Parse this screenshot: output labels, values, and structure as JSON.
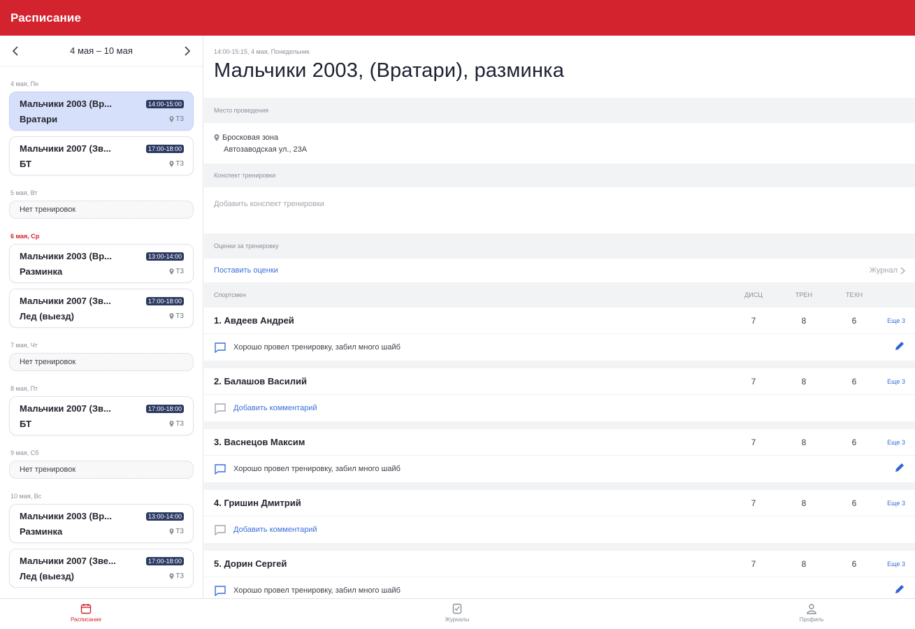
{
  "app": {
    "title": "Расписание",
    "accent": "#d3232e"
  },
  "week": {
    "range": "4 мая – 10 мая"
  },
  "days": [
    {
      "label": "4 мая, Пн",
      "today": false,
      "items": [
        {
          "name": "Мальчики  2003 (Вр...",
          "time": "14:00-15:00",
          "sub": "Вратари",
          "loc": "Т3",
          "selected": true
        },
        {
          "name": "Мальчики  2007 (Зв...",
          "time": "17:00-18:00",
          "sub": "БТ",
          "loc": "Т3",
          "selected": false
        }
      ]
    },
    {
      "label": "5 мая, Вт",
      "today": false,
      "empty": "Нет тренировок"
    },
    {
      "label": "6 мая, Ср",
      "today": true,
      "items": [
        {
          "name": "Мальчики  2003 (Вр...",
          "time": "13:00-14:00",
          "sub": "Разминка",
          "loc": "Т3",
          "selected": false
        },
        {
          "name": "Мальчики  2007 (Зв...",
          "time": "17:00-18:00",
          "sub": "Лед (выезд)",
          "loc": "Т3",
          "selected": false
        }
      ]
    },
    {
      "label": "7 мая, Чт",
      "today": false,
      "empty": "Нет тренировок"
    },
    {
      "label": "8 мая, Пт",
      "today": false,
      "items": [
        {
          "name": "Мальчики  2007 (Зв...",
          "time": "17:00-18:00",
          "sub": "БТ",
          "loc": "Т3",
          "selected": false
        }
      ]
    },
    {
      "label": "9 мая, Сб",
      "today": false,
      "empty": "Нет тренировок"
    },
    {
      "label": "10 мая, Вс",
      "today": false,
      "items": [
        {
          "name": "Мальчики  2003 (Вр...",
          "time": "13:00-14:00",
          "sub": "Разминка",
          "loc": "Т3",
          "selected": false
        },
        {
          "name": "Мальчики  2007 (Зве...",
          "time": "17:00-18:00",
          "sub": "Лед (выезд)",
          "loc": "Т3",
          "selected": false
        }
      ]
    }
  ],
  "detail": {
    "meta": "14:00-15:15, 4 мая, Понедельник",
    "title": "Мальчики 2003, (Вратари), разминка",
    "venue_label": "Место проведения",
    "venue_name": "Бросковая зона",
    "venue_address": "Автозаводская ул., 23А",
    "plan_label": "Конспект тренировки",
    "plan_placeholder": "Добавить конспект тренировки",
    "grades_label": "Оценки за тренировку",
    "grades_link": "Поставить оценки",
    "journal_link": "Журнал",
    "columns": {
      "athlete": "Спортсмен",
      "c1": "ДИСЦ",
      "c2": "ТРЕН",
      "c3": "ТЕХН"
    },
    "athletes": [
      {
        "name": "1. Авдеев Андрей",
        "v1": "7",
        "v2": "8",
        "v3": "6",
        "more": "Еще 3",
        "comment": "Хорошо провел тренировку, забил много шайб",
        "has_comment": true
      },
      {
        "name": "2. Балашов Василий",
        "v1": "7",
        "v2": "8",
        "v3": "6",
        "more": "Еще 3",
        "comment": "Добавить комментарий",
        "has_comment": false
      },
      {
        "name": "3. Васнецов Максим",
        "v1": "7",
        "v2": "8",
        "v3": "6",
        "more": "Еще 3",
        "comment": "Хорошо провел тренировку, забил много шайб",
        "has_comment": true
      },
      {
        "name": "4. Гришин Дмитрий",
        "v1": "7",
        "v2": "8",
        "v3": "6",
        "more": "Еще 3",
        "comment": "Добавить комментарий",
        "has_comment": false
      },
      {
        "name": "5. Дорин Сергей",
        "v1": "7",
        "v2": "8",
        "v3": "6",
        "more": "Еще 3",
        "comment": "Хорошо провел тренировку, забил много шайб",
        "has_comment": true
      }
    ]
  },
  "nav": [
    {
      "label": "Расписание",
      "icon": "calendar-icon",
      "active": true
    },
    {
      "label": "Журналы",
      "icon": "journal-icon",
      "active": false
    },
    {
      "label": "Профиль",
      "icon": "profile-icon",
      "active": false
    }
  ]
}
